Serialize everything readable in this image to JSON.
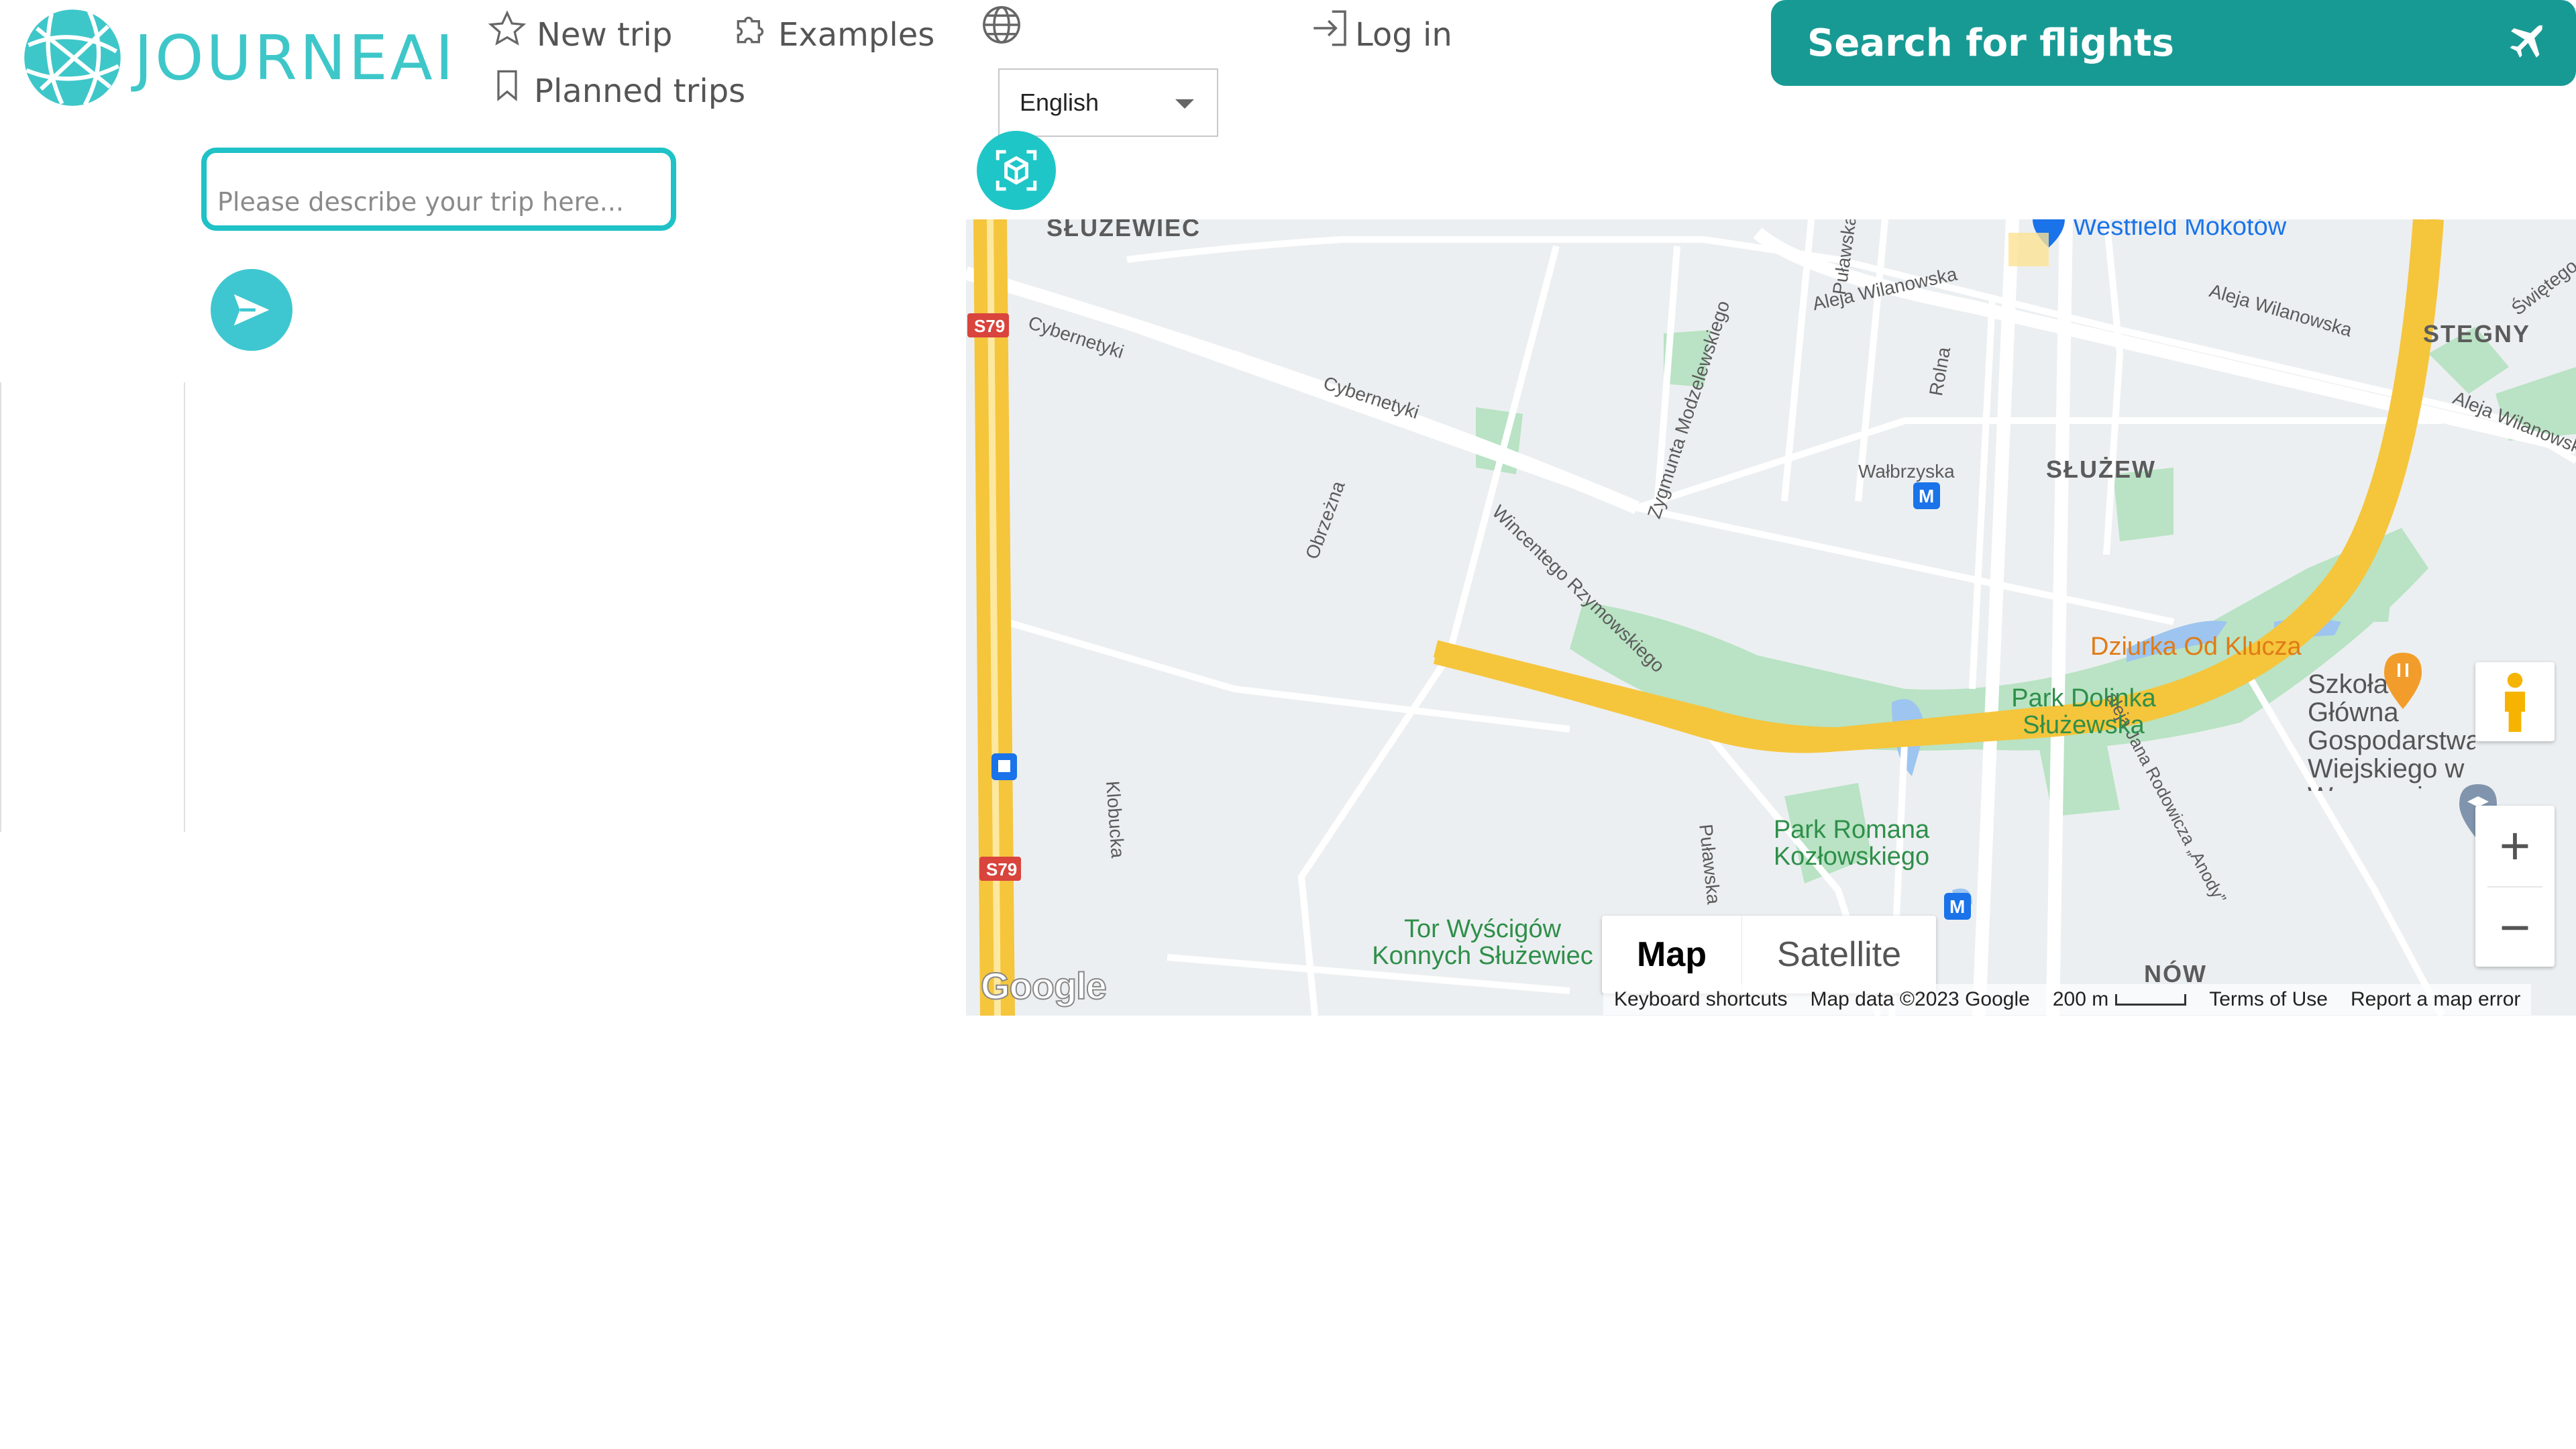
{
  "brand": {
    "name": "JOURNEAI",
    "color": "#3ec7c9"
  },
  "nav": {
    "new_trip": "New trip",
    "planned_trips": "Planned trips",
    "examples": "Examples",
    "login": "Log in"
  },
  "language": {
    "selected": "English"
  },
  "flights_button": {
    "label": "Search for flights",
    "color": "#189a94"
  },
  "trip_input": {
    "placeholder": "Please describe your trip here..."
  },
  "map": {
    "districts": [
      "SŁUŻEWIEC",
      "STEGNY",
      "SŁUŻEW",
      "NÓW"
    ],
    "streets": [
      "Aleja Wilanowska",
      "Aleja Wilanowska",
      "Aleja Wilanowska",
      "Cybernetyki",
      "Cybernetyki",
      "Wincentego Rzymowskiego",
      "Zygmunta Modzelewskiego",
      "Obrzeżna",
      "Wałbrzyska",
      "Rolna",
      "Puławska",
      "Puławska",
      "Klobucka",
      "aleja Jana Rodowicza „Anody”",
      "Świętego Bonifacego"
    ],
    "roads": [
      "S79",
      "S79"
    ],
    "parks": [
      "Park Dolinka Służewska",
      "Park Romana Kozłowskiego",
      "Tor Wyścigów Konnych Służewiec"
    ],
    "pois": [
      "Dziurka Od Klucza",
      "Westfield Mokotów"
    ],
    "school": "Szkoła Główna Gospodarstwa Wiejskiego w Warszawie",
    "type_map": "Map",
    "type_satellite": "Satellite",
    "zoom_in": "+",
    "zoom_out": "−",
    "keyboard_shortcuts": "Keyboard shortcuts",
    "map_data": "Map data ©2023 Google",
    "scale": "200 m",
    "terms": "Terms of Use",
    "report": "Report a map error",
    "google": "Google"
  }
}
